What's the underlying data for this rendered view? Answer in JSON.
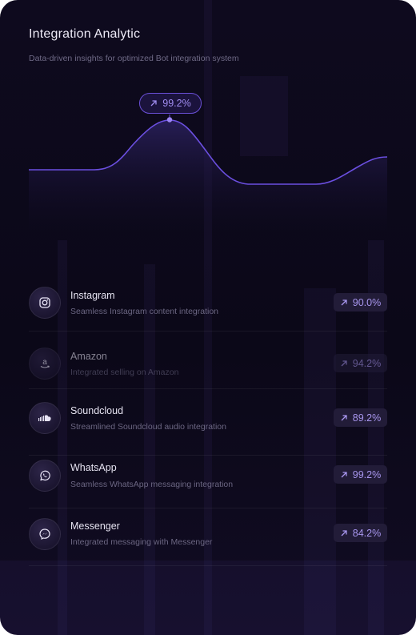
{
  "header": {
    "title": "Integration Analytic",
    "subtitle": "Data-driven insights for optimized Bot integration system"
  },
  "chart_data": {
    "type": "area",
    "peak_label": "99.2%",
    "colors": {
      "line": "#6b4fe0",
      "fill_top": "#3a2c7a",
      "fill_bottom": "#0e0a1e",
      "peak_dot": "#9d86f5"
    }
  },
  "integrations": [
    {
      "name": "Instagram",
      "description": "Seamless Instagram content integration",
      "value": "90.0%",
      "icon": "instagram-icon"
    },
    {
      "name": "Amazon",
      "description": "Integrated selling on Amazon",
      "value": "94.2%",
      "icon": "amazon-icon"
    },
    {
      "name": "Soundcloud",
      "description": "Streamlined Soundcloud audio integration",
      "value": "89.2%",
      "icon": "soundcloud-icon"
    },
    {
      "name": "WhatsApp",
      "description": "Seamless WhatsApp messaging integration",
      "value": "99.2%",
      "icon": "whatsapp-icon"
    },
    {
      "name": "Messenger",
      "description": "Integrated messaging with Messenger",
      "value": "84.2%",
      "icon": "messenger-icon"
    }
  ]
}
